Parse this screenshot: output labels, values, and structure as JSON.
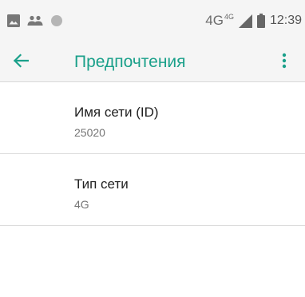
{
  "status_bar": {
    "icons_left": [
      "image-notification-icon",
      "people-notification-icon",
      "circle-notification-icon"
    ],
    "network_label": "4G",
    "network_sup": "4G",
    "time": "12:39"
  },
  "app_bar": {
    "title": "Предпочтения"
  },
  "preferences": [
    {
      "title": "Имя сети (ID)",
      "summary": "25020"
    },
    {
      "title": "Тип сети",
      "summary": "4G"
    }
  ],
  "colors": {
    "accent": "#1aa08a",
    "status_bar_bg": "#f5f5f5",
    "text_primary": "#212121",
    "text_secondary": "#757575"
  }
}
